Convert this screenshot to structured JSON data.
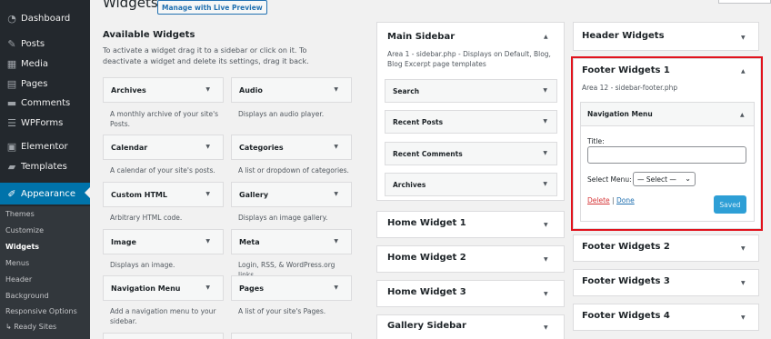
{
  "admin_menu": {
    "items": [
      {
        "label": "Dashboard",
        "icon": "dashboard-icon"
      },
      {
        "label": "Posts",
        "icon": "pin-icon"
      },
      {
        "label": "Media",
        "icon": "media-icon"
      },
      {
        "label": "Pages",
        "icon": "pages-icon"
      },
      {
        "label": "Comments",
        "icon": "comments-icon"
      },
      {
        "label": "WPForms",
        "icon": "forms-icon"
      },
      {
        "label": "Elementor",
        "icon": "elementor-icon"
      },
      {
        "label": "Templates",
        "icon": "folder-icon"
      },
      {
        "label": "Appearance",
        "icon": "brush-icon"
      }
    ],
    "submenu": [
      "Themes",
      "Customize",
      "Widgets",
      "Menus",
      "Header",
      "Background",
      "Responsive Options",
      "↳ Ready Sites"
    ],
    "active_color": "#0073aa"
  },
  "header": {
    "title": "Widgets",
    "live_preview_btn": "Manage with Live Preview"
  },
  "available": {
    "heading": "Available Widgets",
    "description": "To activate a widget drag it to a sidebar or click on it. To deactivate a widget and delete its settings, drag it back.",
    "widgets": [
      {
        "name": "Archives",
        "desc": "A monthly archive of your site's Posts."
      },
      {
        "name": "Audio",
        "desc": "Displays an audio player."
      },
      {
        "name": "Calendar",
        "desc": "A calendar of your site's posts."
      },
      {
        "name": "Categories",
        "desc": "A list or dropdown of categories."
      },
      {
        "name": "Custom HTML",
        "desc": "Arbitrary HTML code."
      },
      {
        "name": "Gallery",
        "desc": "Displays an image gallery."
      },
      {
        "name": "Image",
        "desc": "Displays an image."
      },
      {
        "name": "Meta",
        "desc": "Login, RSS, & WordPress.org links."
      },
      {
        "name": "Navigation Menu",
        "desc": "Add a navigation menu to your sidebar."
      },
      {
        "name": "Pages",
        "desc": "A list of your site's Pages."
      }
    ]
  },
  "main_sidebar": {
    "title": "Main Sidebar",
    "desc": "Area 1 - sidebar.php - Displays on Default, Blog, Blog Excerpt page templates",
    "widgets": [
      "Search",
      "Recent Posts",
      "Recent Comments",
      "Archives"
    ]
  },
  "home_areas": [
    "Home Widget 1",
    "Home Widget 2",
    "Home Widget 3",
    "Gallery Sidebar"
  ],
  "right_areas": {
    "header": "Header Widgets",
    "footer1": {
      "title": "Footer Widgets 1",
      "desc": "Area 12 - sidebar-footer.php",
      "nav_widget": "Navigation Menu",
      "title_label": "Title:",
      "title_value": "",
      "select_label": "Select Menu:",
      "select_value": "— Select —",
      "delete": "Delete",
      "sep": "|",
      "done": "Done",
      "saved": "Saved"
    },
    "others": [
      "Footer Widgets 2",
      "Footer Widgets 3",
      "Footer Widgets 4"
    ]
  },
  "colors": {
    "highlight": "#e1121c",
    "link": "#2271b1",
    "delete": "#d63638"
  }
}
